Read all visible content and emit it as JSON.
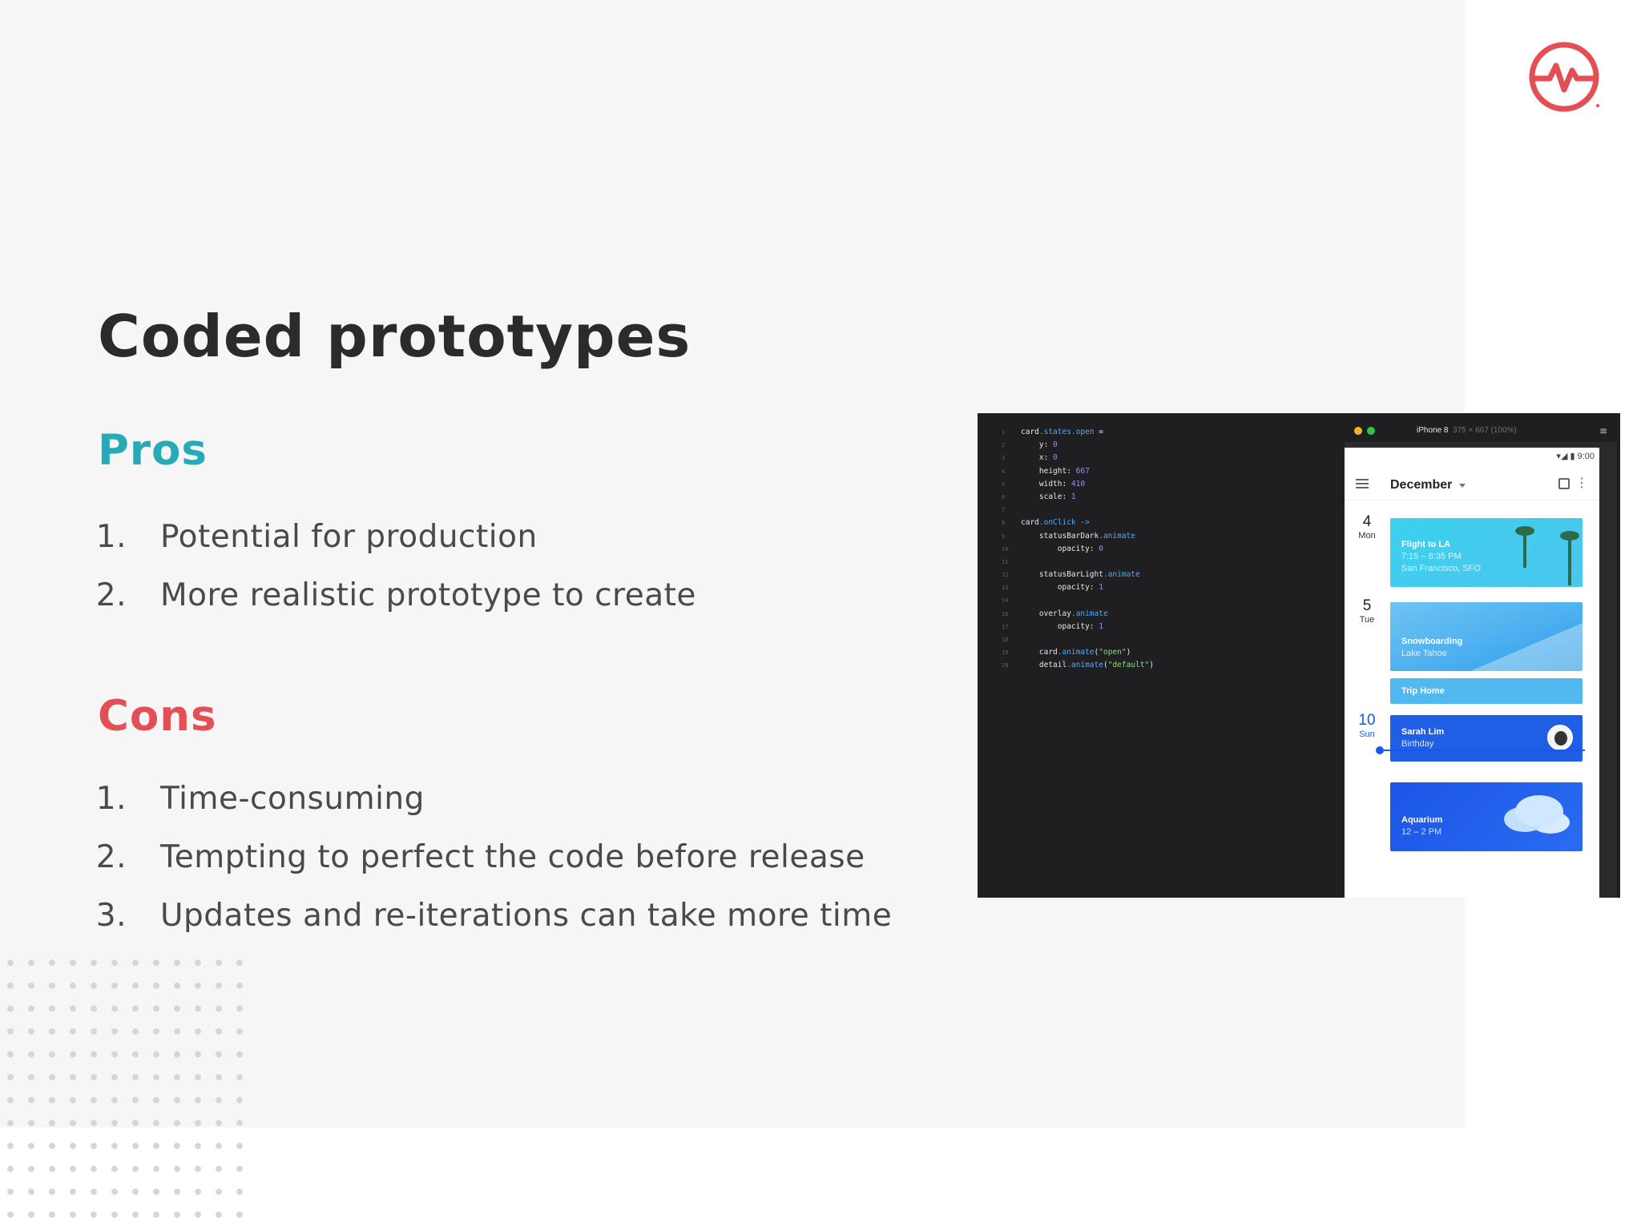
{
  "slide": {
    "title": "Coded prototypes",
    "pros": {
      "heading": "Pros",
      "items": [
        {
          "num": "1.",
          "text": "Potential for production"
        },
        {
          "num": "2.",
          "text": "More realistic prototype to create"
        }
      ]
    },
    "cons": {
      "heading": "Cons",
      "items": [
        {
          "num": "1.",
          "text": "Time-consuming"
        },
        {
          "num": "2.",
          "text": "Tempting to perfect the code before release"
        },
        {
          "num": "3.",
          "text": "Updates and re-iterations can take more time"
        }
      ]
    }
  },
  "colors": {
    "pros_accent": "#26aab7",
    "cons_accent": "#e44f55",
    "logo": "#e44f55",
    "calendar_blue": "#1a57e8"
  },
  "icons": {
    "logo": "heartbeat-circle-icon",
    "menu": "hamburger-icon",
    "calendar": "calendar-icon",
    "more": "more-vertical-icon"
  },
  "code": {
    "lines": [
      {
        "n": "1",
        "parts": [
          [
            "card",
            ""
          ],
          [
            ".states.open",
            "kw"
          ],
          [
            " =",
            ""
          ]
        ]
      },
      {
        "n": "2",
        "parts": [
          [
            "    y: ",
            ""
          ],
          [
            "0",
            "num-c"
          ]
        ]
      },
      {
        "n": "3",
        "parts": [
          [
            "    x: ",
            ""
          ],
          [
            "0",
            "num-c"
          ]
        ]
      },
      {
        "n": "4",
        "parts": [
          [
            "    height: ",
            ""
          ],
          [
            "667",
            "num-c"
          ]
        ]
      },
      {
        "n": "5",
        "parts": [
          [
            "    width: ",
            ""
          ],
          [
            "410",
            "num-c"
          ]
        ]
      },
      {
        "n": "6",
        "parts": [
          [
            "    scale: ",
            ""
          ],
          [
            "1",
            "num-c"
          ]
        ]
      },
      {
        "n": "7",
        "parts": []
      },
      {
        "n": "8",
        "parts": [
          [
            "card",
            ""
          ],
          [
            ".onClick",
            "kw"
          ],
          [
            " ->",
            "kw"
          ]
        ]
      },
      {
        "n": "9",
        "parts": [
          [
            "    statusBarDark",
            ""
          ],
          [
            ".animate",
            "kw"
          ]
        ]
      },
      {
        "n": "10",
        "parts": [
          [
            "        opacity: ",
            ""
          ],
          [
            "0",
            "num-c"
          ]
        ]
      },
      {
        "n": "11",
        "parts": []
      },
      {
        "n": "12",
        "parts": [
          [
            "    statusBarLight",
            ""
          ],
          [
            ".animate",
            "kw"
          ]
        ]
      },
      {
        "n": "13",
        "parts": [
          [
            "        opacity: ",
            ""
          ],
          [
            "1",
            "num-c"
          ]
        ]
      },
      {
        "n": "14",
        "parts": []
      },
      {
        "n": "16",
        "parts": [
          [
            "    overlay",
            ""
          ],
          [
            ".animate",
            "kw"
          ]
        ]
      },
      {
        "n": "17",
        "parts": [
          [
            "        opacity: ",
            ""
          ],
          [
            "1",
            "num-c"
          ]
        ]
      },
      {
        "n": "18",
        "parts": []
      },
      {
        "n": "19",
        "parts": [
          [
            "    card",
            ""
          ],
          [
            ".animate",
            "kw"
          ],
          [
            "(",
            ""
          ],
          [
            "\"open\"",
            "str"
          ],
          [
            ")",
            ""
          ]
        ]
      },
      {
        "n": "20",
        "parts": [
          [
            "    detail",
            ""
          ],
          [
            ".animate",
            "kw"
          ],
          [
            "(",
            ""
          ],
          [
            "\"default\"",
            "str"
          ],
          [
            ")",
            ""
          ]
        ]
      }
    ]
  },
  "phone": {
    "device": "iPhone 8",
    "device_dims": "375 × 667 (100%)",
    "time": "9:00",
    "month": "December",
    "days": [
      {
        "num": "4",
        "weekday": "Mon"
      },
      {
        "num": "5",
        "weekday": "Tue"
      },
      {
        "num": "10",
        "weekday": "Sun"
      }
    ],
    "events": [
      {
        "title": "Flight to LA",
        "sub1": "7:15 – 8:35 PM",
        "sub2": "San Francisco, SFO"
      },
      {
        "title": "Snowboarding",
        "sub1": "Lake Tahoe"
      },
      {
        "title": "Trip Home"
      },
      {
        "title": "Sarah Lim",
        "sub1": "Birthday"
      },
      {
        "title": "Aquarium",
        "sub1": "12 – 2 PM"
      }
    ]
  }
}
